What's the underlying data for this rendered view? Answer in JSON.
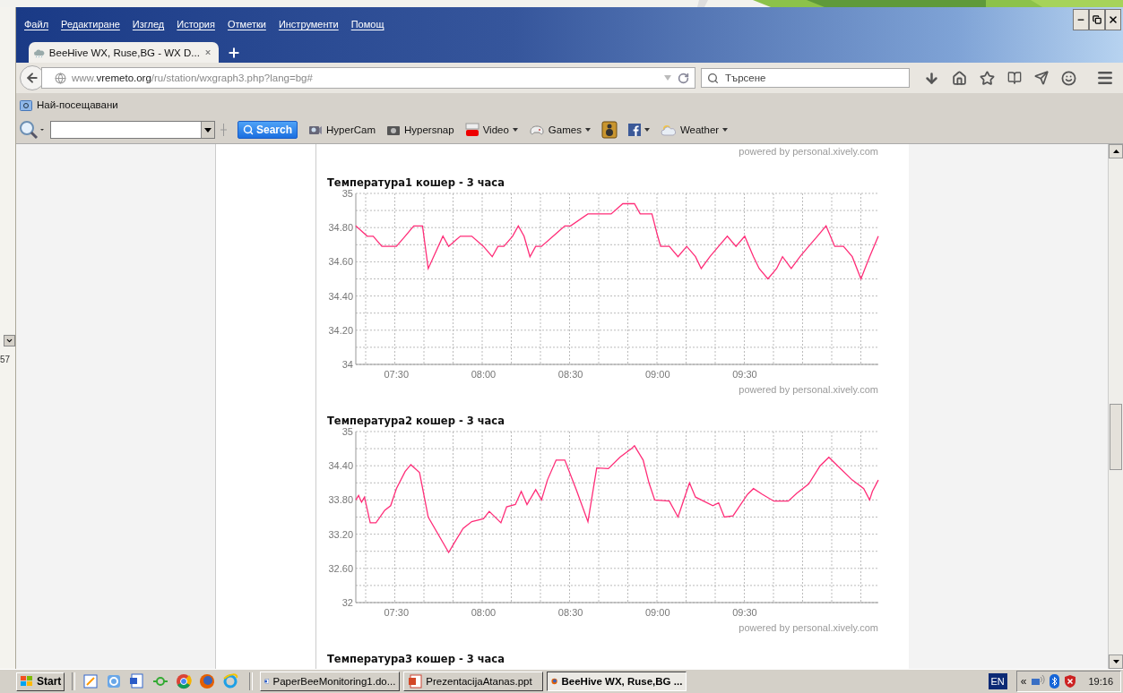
{
  "menu": [
    "Файл",
    "Редактиране",
    "Изглед",
    "История",
    "Отметки",
    "Инструменти",
    "Помощ"
  ],
  "tabs": [
    {
      "title": "BeeHive WX, Ruse,BG - WX D...",
      "selected": true
    }
  ],
  "address": {
    "prefix": "www.",
    "domain": "vremeto.org",
    "path": "/ru/station/wxgraph3.php?lang=bg#"
  },
  "search": {
    "placeholder": "Търсене"
  },
  "bookmarks": [
    {
      "label": "Най-посещавани"
    }
  ],
  "toolbar": {
    "search_button": "Search",
    "items": [
      {
        "kind": "camera",
        "label": "HyperCam",
        "dropdown": false
      },
      {
        "kind": "snapshot",
        "label": "Hypersnap",
        "dropdown": false
      },
      {
        "kind": "video",
        "label": "Video",
        "dropdown": true
      },
      {
        "kind": "games",
        "label": "Games",
        "dropdown": true
      },
      {
        "kind": "speaker",
        "dropdown": false
      },
      {
        "kind": "facebook",
        "dropdown": true
      },
      {
        "kind": "weather",
        "label": "Weather",
        "dropdown": true
      }
    ]
  },
  "left_strip": {
    "label": "57"
  },
  "page": {
    "top_credit": "powered by personal.xively.com",
    "charts": [
      {
        "credit": "powered by personal.xively.com",
        "chart_data": {
          "type": "line",
          "title": "Температура1 кошер - 3 часа",
          "x": [
            7.267,
            7.333,
            7.367,
            7.417,
            7.5,
            7.55,
            7.6,
            7.65,
            7.683,
            7.767,
            7.8,
            7.867,
            7.933,
            8,
            8.05,
            8.083,
            8.117,
            8.167,
            8.2,
            8.233,
            8.267,
            8.3,
            8.333,
            8.4,
            8.467,
            8.5,
            8.6,
            8.667,
            8.733,
            8.8,
            8.867,
            8.9,
            8.967,
            9,
            9.017,
            9.067,
            9.117,
            9.167,
            9.217,
            9.25,
            9.3,
            9.35,
            9.4,
            9.45,
            9.5,
            9.55,
            9.583,
            9.633,
            9.683,
            9.717,
            9.767,
            9.817,
            9.867,
            9.917,
            9.967,
            10.017,
            10.067,
            10.117,
            10.167,
            10.217,
            10.267
          ],
          "series": [
            {
              "color": "#ff2d78",
              "values": [
                34.81,
                34.75,
                34.75,
                34.69,
                34.69,
                34.75,
                34.81,
                34.81,
                34.56,
                34.75,
                34.69,
                34.75,
                34.75,
                34.69,
                34.63,
                34.69,
                34.69,
                34.75,
                34.81,
                34.75,
                34.63,
                34.69,
                34.69,
                34.75,
                34.81,
                34.81,
                34.88,
                34.88,
                34.88,
                34.94,
                34.94,
                34.88,
                34.88,
                34.75,
                34.69,
                34.69,
                34.63,
                34.69,
                34.63,
                34.56,
                34.63,
                34.69,
                34.75,
                34.69,
                34.75,
                34.63,
                34.56,
                34.5,
                34.56,
                34.63,
                34.56,
                34.63,
                34.69,
                34.75,
                34.81,
                34.69,
                34.69,
                34.63,
                34.5,
                34.63,
                34.75
              ]
            }
          ],
          "grid": true,
          "xlim": [
            7.267,
            10.267
          ],
          "ylim": [
            34,
            35
          ],
          "xticks": [
            {
              "value": 7.5,
              "label": "07:30"
            },
            {
              "value": 8,
              "label": "08:00"
            },
            {
              "value": 8.5,
              "label": "08:30"
            },
            {
              "value": 9,
              "label": "09:00"
            },
            {
              "value": 9.5,
              "label": "09:30"
            }
          ],
          "yticks": [
            {
              "value": 34,
              "label": "34"
            },
            {
              "value": 34.2,
              "label": "34.20"
            },
            {
              "value": 34.4,
              "label": "34.40"
            },
            {
              "value": 34.6,
              "label": "34.60"
            },
            {
              "value": 34.8,
              "label": "34.80"
            },
            {
              "value": 35,
              "label": "35"
            }
          ]
        }
      },
      {
        "credit": "powered by personal.xively.com",
        "chart_data": {
          "type": "line",
          "title": "Температура2 кошер - 3 часа",
          "x": [
            7.267,
            7.283,
            7.3,
            7.317,
            7.35,
            7.383,
            7.433,
            7.467,
            7.5,
            7.55,
            7.583,
            7.633,
            7.683,
            7.8,
            7.833,
            7.883,
            7.933,
            8,
            8.033,
            8.1,
            8.133,
            8.183,
            8.217,
            8.25,
            8.3,
            8.333,
            8.367,
            8.417,
            8.467,
            8.533,
            8.6,
            8.65,
            8.717,
            8.783,
            8.85,
            8.867,
            8.917,
            8.95,
            8.983,
            9.067,
            9.117,
            9.183,
            9.217,
            9.317,
            9.35,
            9.383,
            9.433,
            9.517,
            9.55,
            9.6,
            9.667,
            9.75,
            9.8,
            9.867,
            9.933,
            9.983,
            10.033,
            10.117,
            10.183,
            10.217,
            10.233,
            10.267
          ],
          "series": [
            {
              "color": "#ff2d78",
              "values": [
                33.8,
                33.88,
                33.76,
                33.85,
                33.4,
                33.4,
                33.62,
                33.7,
                34,
                34.3,
                34.42,
                34.28,
                33.5,
                32.88,
                33.05,
                33.3,
                33.42,
                33.47,
                33.6,
                33.4,
                33.68,
                33.72,
                33.95,
                33.72,
                33.98,
                33.8,
                34.15,
                34.5,
                34.5,
                33.98,
                33.42,
                34.36,
                34.35,
                34.55,
                34.7,
                34.75,
                34.5,
                34.1,
                33.8,
                33.78,
                33.5,
                34.1,
                33.85,
                33.7,
                33.75,
                33.5,
                33.52,
                33.9,
                34,
                33.9,
                33.78,
                33.78,
                33.92,
                34.08,
                34.4,
                34.55,
                34.4,
                34.15,
                34,
                33.8,
                33.95,
                34.15
              ]
            }
          ],
          "grid": true,
          "xlim": [
            7.267,
            10.267
          ],
          "ylim": [
            32,
            35
          ],
          "xticks": [
            {
              "value": 7.5,
              "label": "07:30"
            },
            {
              "value": 8,
              "label": "08:00"
            },
            {
              "value": 8.5,
              "label": "08:30"
            },
            {
              "value": 9,
              "label": "09:00"
            },
            {
              "value": 9.5,
              "label": "09:30"
            }
          ],
          "yticks": [
            {
              "value": 32,
              "label": "32"
            },
            {
              "value": 32.6,
              "label": "32.60"
            },
            {
              "value": 33.2,
              "label": "33.20"
            },
            {
              "value": 33.8,
              "label": "33.80"
            },
            {
              "value": 34.4,
              "label": "34.40"
            },
            {
              "value": 35,
              "label": "35"
            }
          ]
        }
      }
    ],
    "next_title": "Температура3 кошер - 3 часа"
  },
  "taskbar": {
    "start": "Start",
    "tasks": [
      {
        "kind": "word",
        "label": "PaperBeeMonitoring1.do...",
        "selected": false
      },
      {
        "kind": "ppt",
        "label": "PrezentacijaAtanas.ppt",
        "selected": false
      },
      {
        "kind": "firefox",
        "label": "BeeHive WX, Ruse,BG ...",
        "selected": true
      }
    ],
    "language": "EN",
    "tray_toggle": "«",
    "clock": "19:16"
  }
}
